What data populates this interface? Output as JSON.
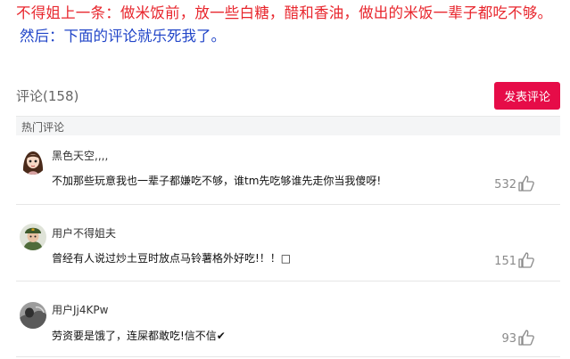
{
  "post": {
    "line1": "不得姐上一条：做米饭前，放一些白糖，醋和香油，做出的米饭一辈子都吃不够。",
    "line2": "然后：下面的评论就乐死我了。"
  },
  "comments_header": {
    "count_label": "评论(158)",
    "post_button": "发表评论"
  },
  "section": {
    "hot_label": "热门评论"
  },
  "comments": [
    {
      "username": "黑色天空,,,,",
      "text": "不加那些玩意我也一辈子都嫌吃不够，谁tm先吃够谁先走你当我傻呀!",
      "likes": "532",
      "avatar": "girl-avatar"
    },
    {
      "username": "用户不得姐夫",
      "text": "曾经有人说过炒土豆时放点马铃薯格外好吃!！！□",
      "likes": "151",
      "avatar": "soldier-avatar"
    },
    {
      "username": "用户Jj4KPw",
      "text": "劳资要是饿了，连屎都敢吃!信不信✔",
      "likes": "93",
      "avatar": "gray-avatar"
    }
  ],
  "colors": {
    "red_text": "#e8262d",
    "blue_text": "#2145c8",
    "button": "#e60c48"
  }
}
